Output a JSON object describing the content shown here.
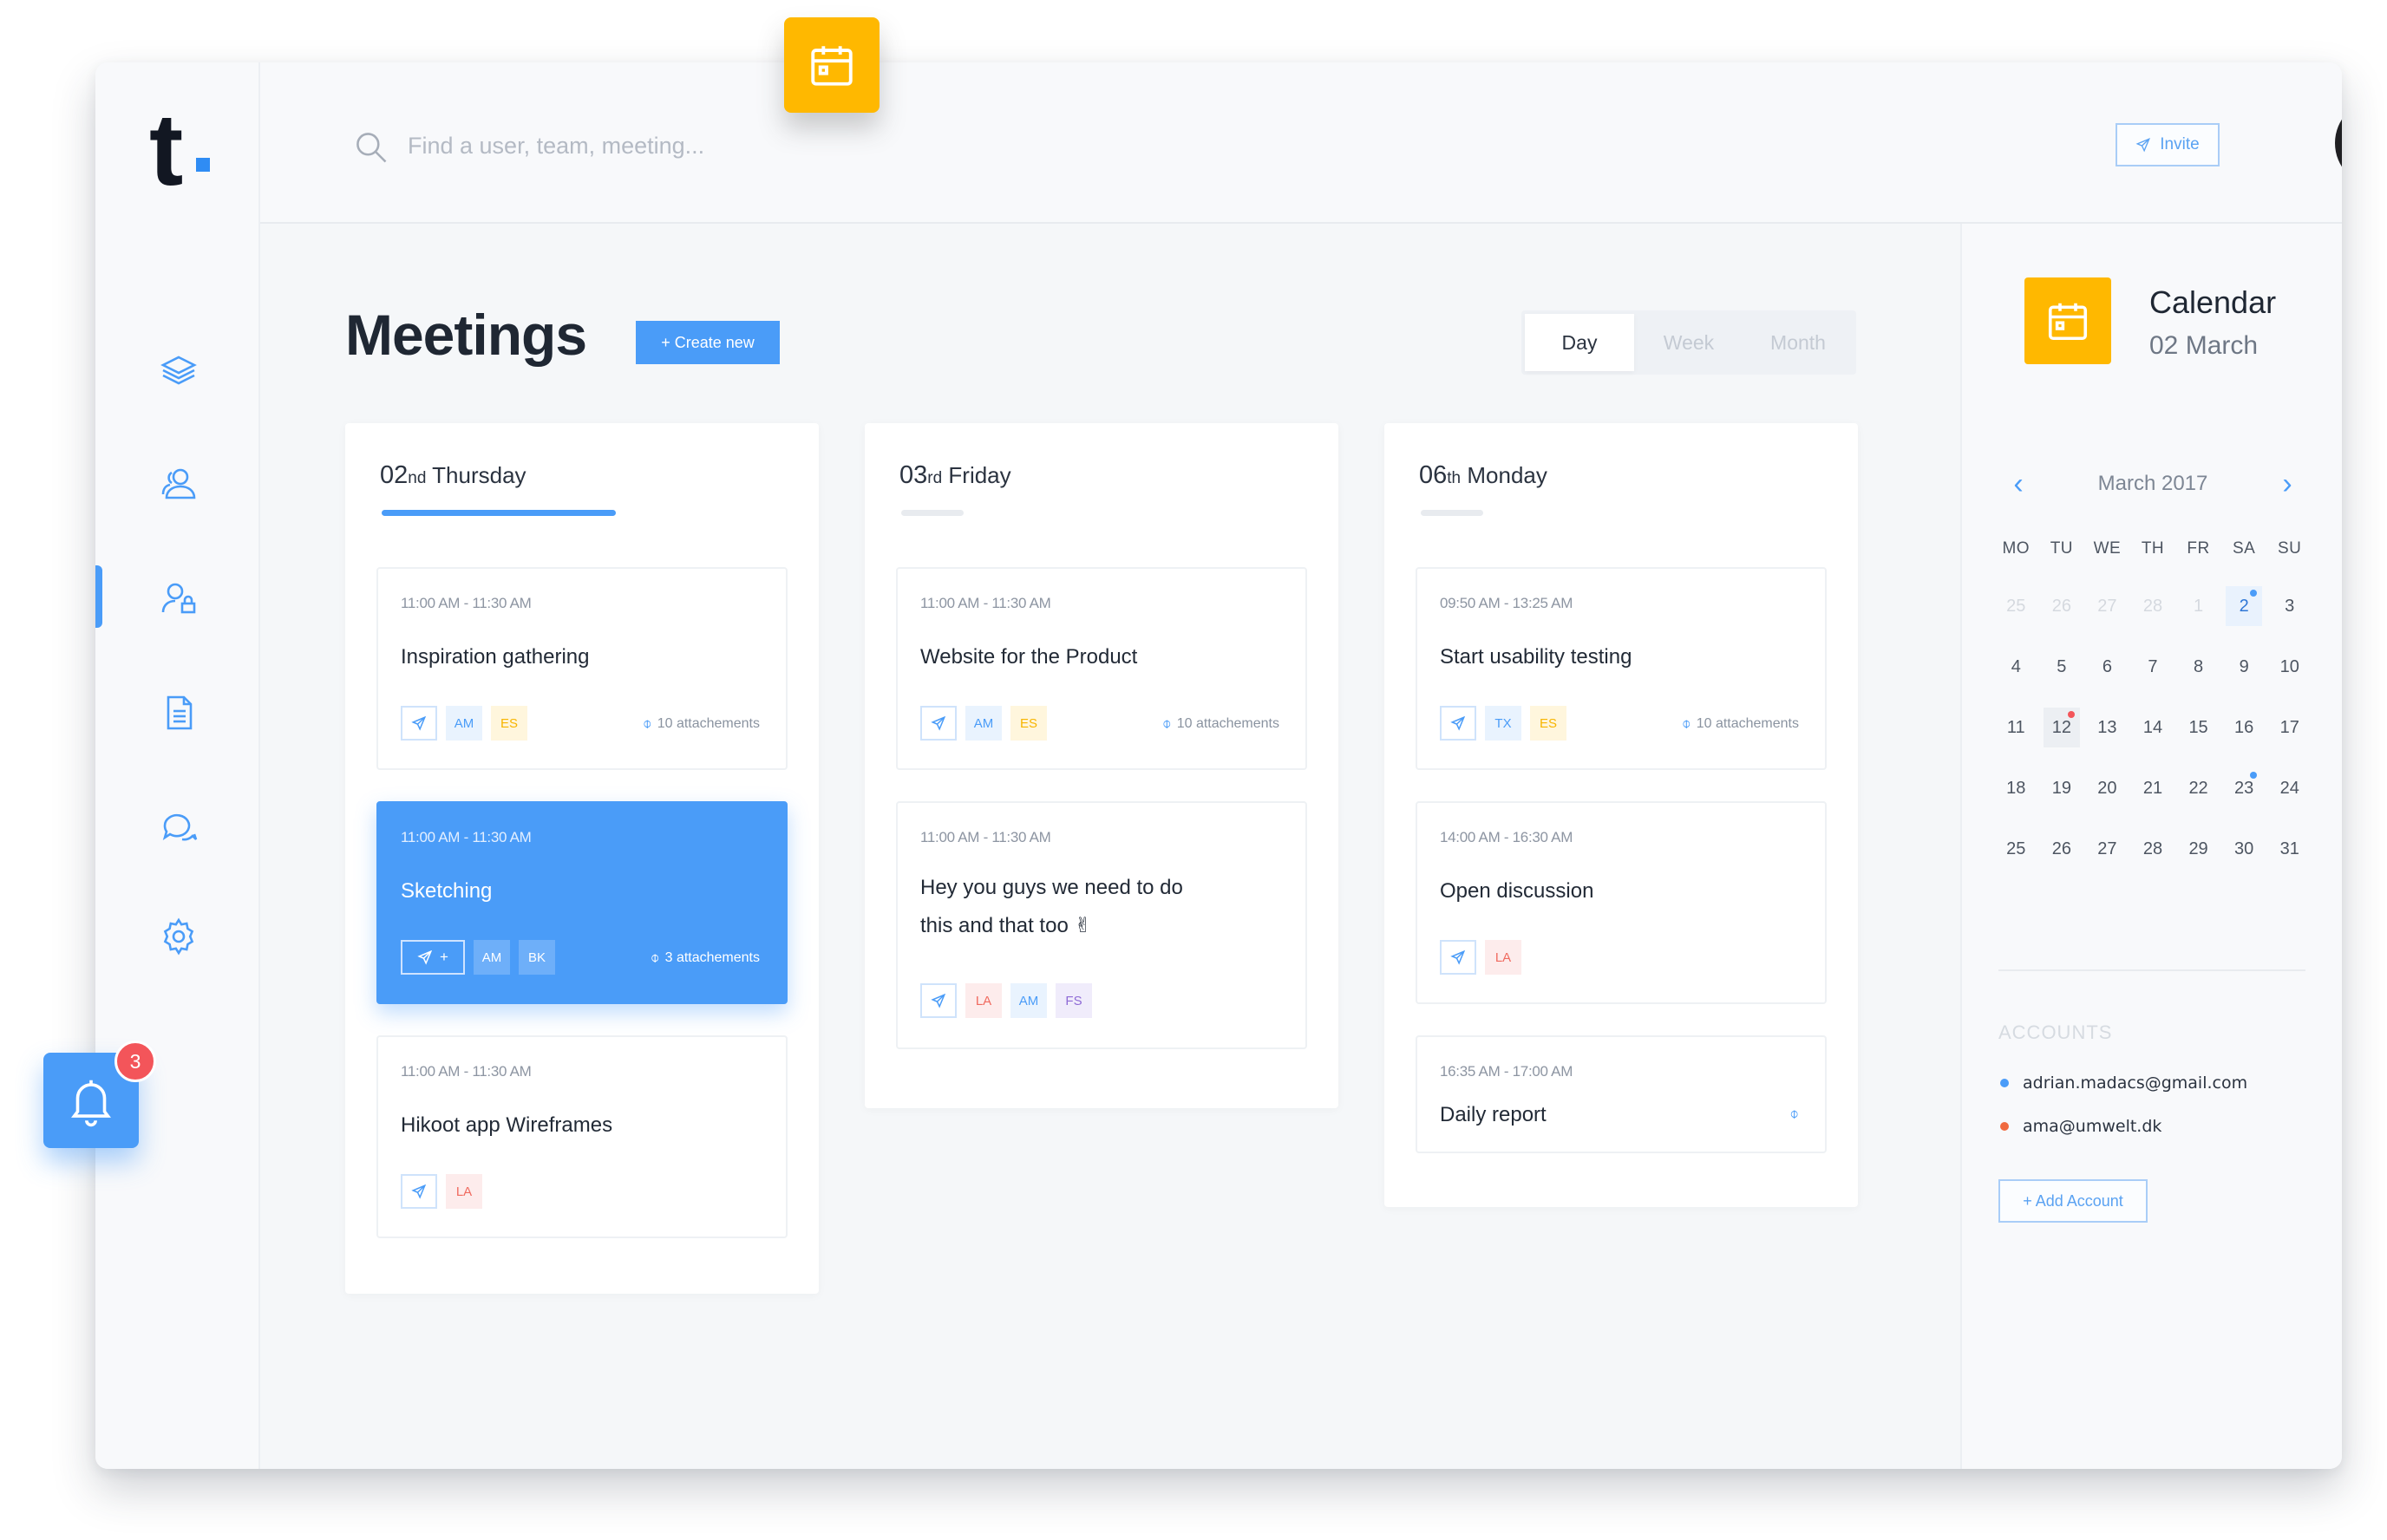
{
  "brand": {
    "logo_text": "t",
    "accent": "#4a9cf8",
    "yellow": "#ffb800"
  },
  "search": {
    "placeholder": "Find a user, team, meeting..."
  },
  "header": {
    "invite_label": "Invite"
  },
  "sidebar": {
    "items": [
      {
        "icon": "layers-icon"
      },
      {
        "icon": "users-icon"
      },
      {
        "icon": "user-lock-icon",
        "active": true
      },
      {
        "icon": "document-icon"
      },
      {
        "icon": "chat-icon"
      },
      {
        "icon": "gear-icon"
      }
    ]
  },
  "notifications": {
    "count": "3"
  },
  "main": {
    "title": "Meetings",
    "create_label": "+ Create new",
    "views": [
      "Day",
      "Week",
      "Month"
    ],
    "active_view": "Day"
  },
  "days": [
    {
      "num": "02",
      "suffix": "nd",
      "name": "Thursday",
      "meetings": [
        {
          "time": "11:00 AM - 11:30 AM",
          "title": "Inspiration gathering",
          "chips": [
            "AM",
            "ES"
          ],
          "attachments": "10 attachements"
        },
        {
          "time": "11:00 AM - 11:30 AM",
          "title": "Sketching",
          "chips": [
            "AM",
            "BK"
          ],
          "attachments": "3 attachements",
          "send_extra": "+"
        },
        {
          "time": "11:00 AM - 11:30 AM",
          "title": "Hikoot app Wireframes",
          "chips": [
            "LA"
          ]
        }
      ]
    },
    {
      "num": "03",
      "suffix": "rd",
      "name": "Friday",
      "meetings": [
        {
          "time": "11:00 AM - 11:30 AM",
          "title": "Website for the Product",
          "chips": [
            "AM",
            "ES"
          ],
          "attachments": "10 attachements"
        },
        {
          "time": "11:00 AM - 11:30 AM",
          "title": "Hey you guys we need to do this and that too ✌",
          "chips": [
            "LA",
            "AM",
            "FS"
          ]
        }
      ]
    },
    {
      "num": "06",
      "suffix": "th",
      "name": "Monday",
      "meetings": [
        {
          "time": "09:50 AM - 13:25 AM",
          "title": "Start usability testing",
          "chips": [
            "TX",
            "ES"
          ],
          "attachments": "10 attachements"
        },
        {
          "time": "14:00 AM - 16:30 AM",
          "title": "Open discussion",
          "chips": [
            "LA"
          ]
        },
        {
          "time": "16:35 AM - 17:00 AM",
          "title": "Daily report"
        }
      ]
    }
  ],
  "calendar": {
    "title": "Calendar",
    "subtitle": "02 March",
    "month_label": "March 2017",
    "dow": [
      "MO",
      "TU",
      "WE",
      "TH",
      "FR",
      "SA",
      "SU"
    ],
    "weeks": [
      [
        "25",
        "26",
        "27",
        "28",
        "1",
        "2",
        "3"
      ],
      [
        "4",
        "5",
        "6",
        "7",
        "8",
        "9",
        "10"
      ],
      [
        "11",
        "12",
        "13",
        "14",
        "15",
        "16",
        "17"
      ],
      [
        "18",
        "19",
        "20",
        "21",
        "22",
        "23",
        "24"
      ],
      [
        "25",
        "26",
        "27",
        "28",
        "29",
        "30",
        "31"
      ]
    ],
    "accounts_heading": "ACCOUNTS",
    "accounts": [
      {
        "email": "adrian.madacs@gmail.com",
        "color": "#4a9cf8"
      },
      {
        "email": "ama@umwelt.dk",
        "color": "#f06a3f"
      }
    ],
    "add_account_label": "+ Add Account"
  }
}
